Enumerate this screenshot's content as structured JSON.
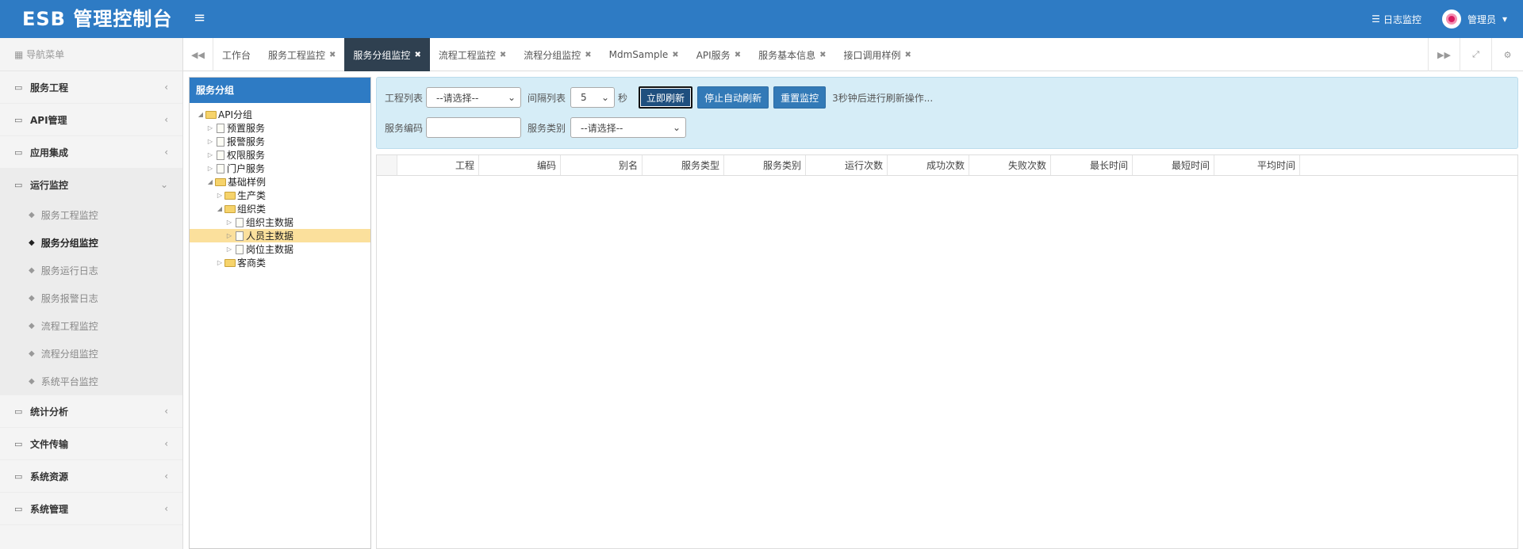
{
  "header": {
    "logo": "ESB 管理控制台",
    "menu_toggle": "≡",
    "log_monitor": "日志监控",
    "user": "管理员"
  },
  "sidebar": {
    "nav_title": "导航菜单",
    "groups_before": [
      {
        "label": "服务工程"
      },
      {
        "label": "API管理"
      },
      {
        "label": "应用集成"
      }
    ],
    "open_group": {
      "label": "运行监控",
      "items": [
        {
          "label": "服务工程监控",
          "active": false
        },
        {
          "label": "服务分组监控",
          "active": true
        },
        {
          "label": "服务运行日志",
          "active": false
        },
        {
          "label": "服务报警日志",
          "active": false
        },
        {
          "label": "流程工程监控",
          "active": false
        },
        {
          "label": "流程分组监控",
          "active": false
        },
        {
          "label": "系统平台监控",
          "active": false
        }
      ]
    },
    "groups_after": [
      {
        "label": "统计分析"
      },
      {
        "label": "文件传输"
      },
      {
        "label": "系统资源"
      },
      {
        "label": "系统管理"
      }
    ]
  },
  "tabs": [
    {
      "label": "工作台",
      "closable": false,
      "active": false
    },
    {
      "label": "服务工程监控",
      "closable": true,
      "active": false
    },
    {
      "label": "服务分组监控",
      "closable": true,
      "active": true
    },
    {
      "label": "流程工程监控",
      "closable": true,
      "active": false
    },
    {
      "label": "流程分组监控",
      "closable": true,
      "active": false
    },
    {
      "label": "MdmSample",
      "closable": true,
      "active": false
    },
    {
      "label": "API服务",
      "closable": true,
      "active": false
    },
    {
      "label": "服务基本信息",
      "closable": true,
      "active": false
    },
    {
      "label": "接口调用样例",
      "closable": true,
      "active": false
    }
  ],
  "tree": {
    "title": "服务分组",
    "nodes": [
      {
        "label": "API分组",
        "level": 0,
        "type": "folder",
        "expanded": true
      },
      {
        "label": "预置服务",
        "level": 1,
        "type": "file"
      },
      {
        "label": "报警服务",
        "level": 1,
        "type": "file"
      },
      {
        "label": "权限服务",
        "level": 1,
        "type": "file"
      },
      {
        "label": "门户服务",
        "level": 1,
        "type": "file"
      },
      {
        "label": "基础样例",
        "level": 1,
        "type": "folder",
        "expanded": true
      },
      {
        "label": "生产类",
        "level": 2,
        "type": "folder",
        "expanded": false
      },
      {
        "label": "组织类",
        "level": 2,
        "type": "folder",
        "expanded": true
      },
      {
        "label": "组织主数据",
        "level": 3,
        "type": "file"
      },
      {
        "label": "人员主数据",
        "level": 3,
        "type": "file",
        "selected": true
      },
      {
        "label": "岗位主数据",
        "level": 3,
        "type": "file"
      },
      {
        "label": "客商类",
        "level": 2,
        "type": "folder",
        "expanded": false
      }
    ]
  },
  "filters": {
    "project_label": "工程列表",
    "project_value": "--请选择--",
    "interval_label": "间隔列表",
    "interval_value": "5",
    "interval_unit": "秒",
    "refresh_now": "立即刷新",
    "stop_refresh": "停止自动刷新",
    "reset": "重置监控",
    "countdown_text": "3秒钟后进行刷新操作...",
    "code_label": "服务编码",
    "code_value": "",
    "category_label": "服务类别",
    "category_value": "--请选择--"
  },
  "grid": {
    "columns": [
      "工程",
      "编码",
      "别名",
      "服务类型",
      "服务类别",
      "运行次数",
      "成功次数",
      "失败次数",
      "最长时间",
      "最短时间",
      "平均时间"
    ],
    "rows": []
  },
  "colors": {
    "brand": "#2e7bc4",
    "active_tab": "#2f4050",
    "filter_bg": "#d6edf7",
    "tree_selected": "#fbe09c"
  }
}
